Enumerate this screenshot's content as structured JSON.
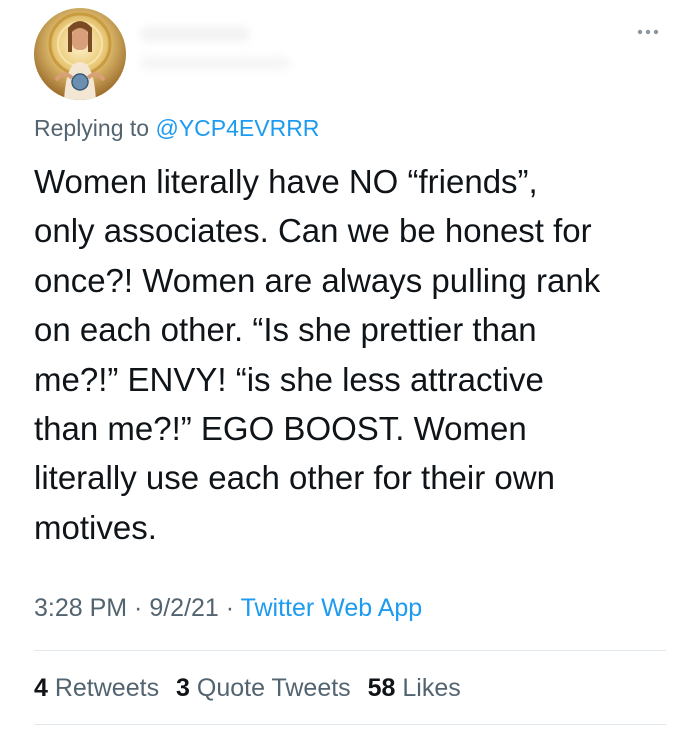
{
  "tweet": {
    "replying_prefix": "Replying to ",
    "replying_to": "@YCP4EVRRR",
    "text_lines": [
      "Women literally have NO “friends”,",
      "only associates. Can we be honest for",
      "once?! Women are always pulling rank",
      "on each other. “Is she prettier than",
      "me?!” ENVY! “is she less attractive",
      "than me?!” EGO BOOST. Women",
      "literally use each other for their own",
      "motives."
    ],
    "time": "3:28 PM",
    "separator": " · ",
    "date": "9/2/21",
    "source": "Twitter Web App"
  },
  "stats": {
    "retweets_count": "4",
    "retweets_label": " Retweets",
    "quote_count": "3",
    "quote_label": " Quote Tweets",
    "likes_count": "58",
    "likes_label": " Likes"
  },
  "icons": {
    "more": "more-horizontal-icon"
  },
  "colors": {
    "link": "#1d9bf0",
    "secondary_text": "#536471",
    "primary_text": "#0f1419",
    "divider": "#e1e8ed"
  }
}
